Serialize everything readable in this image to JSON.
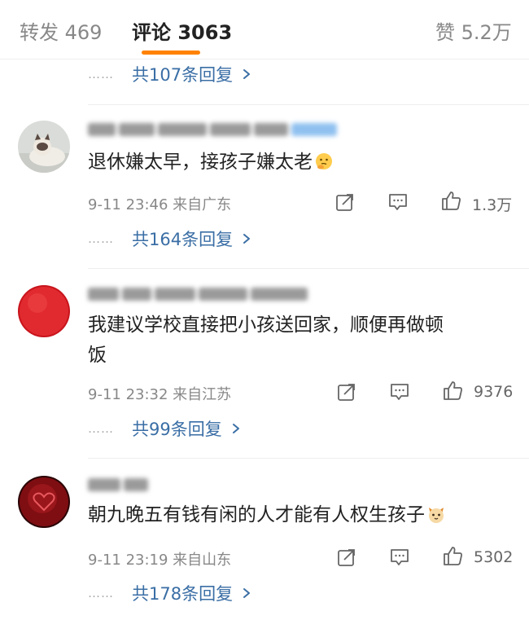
{
  "tabs": {
    "repost": "转发 469",
    "comment": "评论 3063",
    "like": "赞 5.2万"
  },
  "accent_color": "#ff8200",
  "link_color": "#3a6ea5",
  "top_reply": {
    "dots": "……",
    "text": "共107条回复"
  },
  "comments": [
    {
      "avatar_icon": "cat-photo",
      "text": "退休嫌太早，接孩子嫌太老",
      "emoji_icon": "thinking-emoji",
      "meta": "9-11 23:46 来自广东",
      "likes": "1.3万",
      "reply": {
        "dots": "……",
        "text": "共164条回复"
      }
    },
    {
      "avatar_icon": "red-ball",
      "text_line1": "我建议学校直接把小孩送回家，顺便再做顿",
      "text_line2": "饭",
      "meta": "9-11 23:32 来自江苏",
      "likes": "9376",
      "reply": {
        "dots": "……",
        "text": "共99条回复"
      }
    },
    {
      "avatar_icon": "heart-in-sand",
      "text": "朝九晚五有钱有闲的人才能有人权生孩子",
      "emoji_icon": "cat-face-emoji",
      "meta": "9-11 23:19 来自山东",
      "likes": "5302",
      "reply": {
        "dots": "……",
        "text": "共178条回复"
      }
    }
  ]
}
